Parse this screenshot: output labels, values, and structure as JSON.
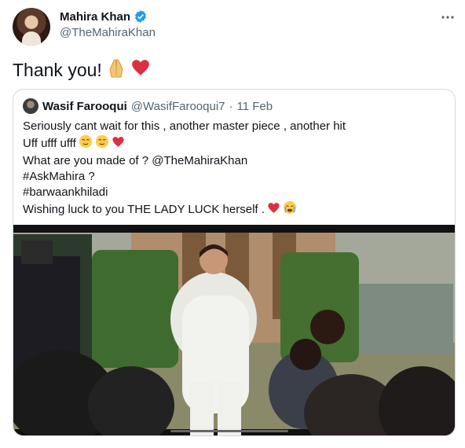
{
  "author": {
    "display_name": "Mahira Khan",
    "handle": "@TheMahiraKhan",
    "avatar_icon": "profile-photo",
    "verified_icon": "verified-badge-icon"
  },
  "tweet": {
    "text": "Thank you!",
    "emojis": [
      "folded-hands-icon",
      "red-heart-icon"
    ]
  },
  "quoted_tweet": {
    "author_name": "Wasif Farooqui",
    "author_handle": "@WasifFarooqui7",
    "separator": "·",
    "date": "11 Feb",
    "lines": [
      "Seriously cant wait for this , another master piece , another hit",
      "Uff ufff ufff",
      "What are you made of ? @TheMahiraKhan",
      "#AskMahira  ?",
      "#barwaankhiladi",
      "Wishing luck to you THE LADY LUCK herself ."
    ]
  },
  "colors": {
    "text": "#0f1419",
    "secondary": "#536471",
    "verified": "#1d9bf0",
    "border": "#cfd9de",
    "heart": "#e0245e"
  }
}
